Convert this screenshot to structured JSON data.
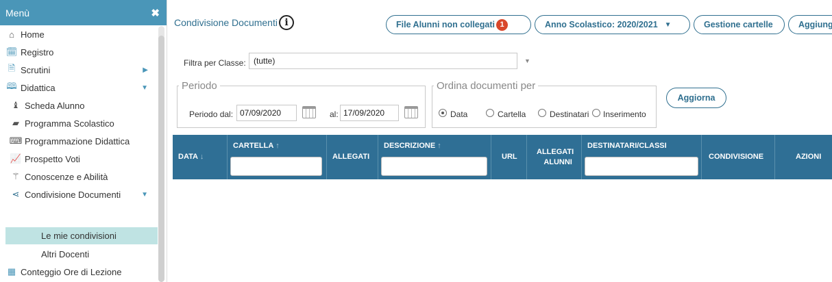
{
  "sidebar": {
    "title": "Menù",
    "close_icon": "✖",
    "items": [
      {
        "label": "Home",
        "icon": "home-icon"
      },
      {
        "label": "Registro",
        "icon": "calendar-check-icon"
      },
      {
        "label": "Scrutini",
        "icon": "report-icon"
      },
      {
        "label": "Didattica",
        "icon": "book-icon"
      },
      {
        "label": "Scheda Alunno",
        "icon": "student-icon"
      },
      {
        "label": "Programma Scolastico",
        "icon": "notebook-icon"
      },
      {
        "label": "Programmazione Didattica",
        "icon": "keyboard-icon"
      },
      {
        "label": "Prospetto Voti",
        "icon": "line-chart-icon"
      },
      {
        "label": "Conoscenze e Abilità",
        "icon": "magic-wand-icon"
      },
      {
        "label": "Condivisione Documenti",
        "icon": "share-icon"
      },
      {
        "label": "Le mie condivisioni",
        "icon": ""
      },
      {
        "label": "Altri Docenti",
        "icon": ""
      },
      {
        "label": "Conteggio Ore di Lezione",
        "icon": "table-icon"
      }
    ]
  },
  "header": {
    "title": "Condivisione Documenti",
    "info_icon": "i",
    "buttons": {
      "file_alunni": "File Alunni non collegati",
      "badge": "1",
      "anno": "Anno Scolastico: 2020/2021",
      "gestione": "Gestione cartelle",
      "aggiungi": "Aggiungi"
    }
  },
  "filter": {
    "label": "Filtra per Classe:",
    "value": "(tutte)"
  },
  "periodo": {
    "legend": "Periodo",
    "from_label": "Periodo dal:",
    "from_value": "07/09/2020",
    "to_label": "al:",
    "to_value": "17/09/2020"
  },
  "ordina": {
    "legend": "Ordina documenti per",
    "options": [
      "Data",
      "Cartella",
      "Destinatari",
      "Inserimento"
    ],
    "selected": "Data"
  },
  "aggiorna_label": "Aggiorna",
  "table": {
    "columns": [
      "DATA",
      "CARTELLA",
      "ALLEGATI",
      "DESCRIZIONE",
      "URL",
      "ALLEGATI",
      "ALUNNI",
      "DESTINATARI/CLASSI",
      "CONDIVISIONE",
      "AZIONI"
    ]
  },
  "colors": {
    "accent": "#2f6f8f",
    "sidebar_header": "#4a96b8",
    "table_header": "#2f6f95",
    "badge": "#d9472b",
    "active_item": "#bfe3e3"
  }
}
